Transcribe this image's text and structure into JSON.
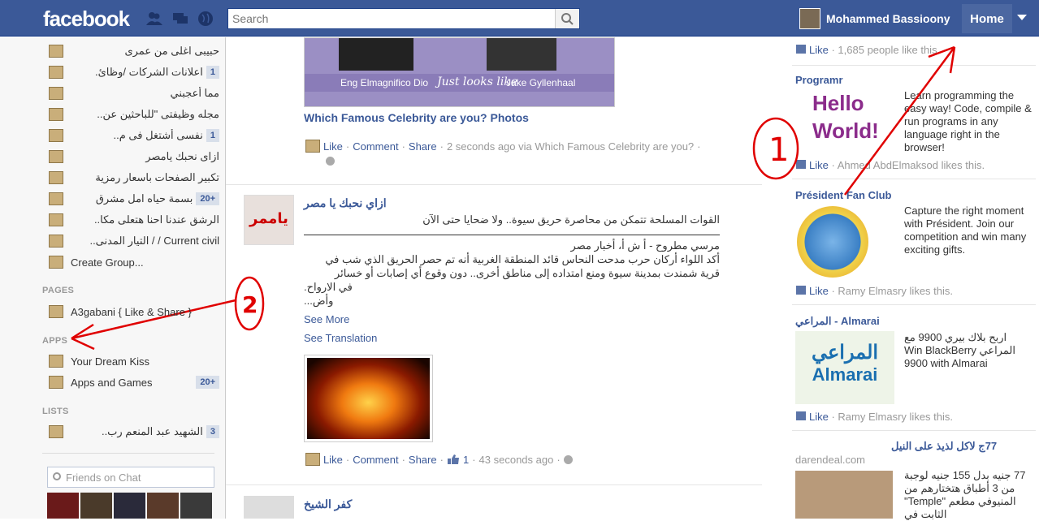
{
  "topbar": {
    "logo": "facebook",
    "search_placeholder": "Search",
    "user_name": "Mohammed Bassioony",
    "home_label": "Home"
  },
  "sidebar": {
    "items": [
      {
        "label": "حبيبى اغلى من عمرى",
        "count": ""
      },
      {
        "label": "اعلانات الشركات /وظائ.",
        "count": "1"
      },
      {
        "label": "مما أعجبني",
        "count": ""
      },
      {
        "label": "مجله وظيفتى \"للباحثين عن..",
        "count": ""
      },
      {
        "label": "نفسى أشتغل فى م..",
        "count": "1"
      },
      {
        "label": "ازاى نحبك يامصر",
        "count": ""
      },
      {
        "label": "تكبير الصفحات باسعار رمزية",
        "count": ""
      },
      {
        "label": "بسمة حياه امل مشرق",
        "count": "20+"
      },
      {
        "label": "الرشق عندنا احنا هتعلى مكا..",
        "count": ""
      },
      {
        "label": "Current civil / / التيار المدنى..",
        "count": ""
      },
      {
        "label": "Create Group...",
        "count": ""
      }
    ],
    "pages_header": "PAGES",
    "pages": [
      {
        "label": "A3gabani { Like & Share }",
        "count": ""
      }
    ],
    "apps_header": "APPS",
    "apps": [
      {
        "label": "Your Dream Kiss",
        "count": ""
      },
      {
        "label": "Apps and Games",
        "count": "20+"
      }
    ],
    "lists_header": "LISTS",
    "lists": [
      {
        "label": "الشهيد عبد المنعم رب..",
        "count": "3"
      }
    ],
    "chat_placeholder": "Friends on Chat"
  },
  "feed": {
    "photo_caption_left": "Eng Elmagnifico Dio",
    "photo_caption_mid": "Just looks like",
    "photo_caption_right": "Jake Gyllenhaal",
    "story1_title": "Which Famous Celebrity are you? Photos",
    "story1_actions": {
      "like": "Like",
      "comment": "Comment",
      "share": "Share",
      "time": "2 seconds ago via Which Famous Celebrity are you?"
    },
    "story2_author": "ازاي نحبك يا مصر",
    "story2_line1": "القوات المسلحة تتمكن من محاصرة حريق سيوة.. ولا ضحايا حتى الآن",
    "story2_line2": "مرسي مطروح - أ ش أ، أخبار مصر",
    "story2_line3": "أكد اللواء أركان حرب مدحت النحاس قائد المنطقة الغربية أنه تم حصر الحريق الذي شب في",
    "story2_line4": "قرية شمندت بمدينة سيوة ومنع امتداده إلى مناطق أخرى.. دون وقوع أي إصابات أو خسائر",
    "story2_line5": "في الارواح.",
    "story2_line6": "وأض...",
    "see_more": "See More",
    "see_translation": "See Translation",
    "story2_actions": {
      "like": "Like",
      "comment": "Comment",
      "share": "Share",
      "likes": "1",
      "time": "43 seconds ago"
    },
    "story3_author": "كفر الشيخ"
  },
  "ads": {
    "top_like": "Like",
    "top_like_text": "1,685 people like this.",
    "ad1_title": "Programr",
    "ad1_image_text1": "Hello",
    "ad1_image_text2": "World!",
    "ad1_text": "Learn programming the easy way! Code, compile & run programs in any language right in the browser!",
    "ad1_like": "Like",
    "ad1_like_text": "Ahmed AbdElmaksod likes this.",
    "ad2_title": "Président Fan Club",
    "ad2_text": "Capture the right moment with Président. Join our competition and win many exciting gifts.",
    "ad2_like": "Like",
    "ad2_like_text": "Ramy Elmasry likes this.",
    "ad3_title": "المراعي - Almarai",
    "ad3_image_ar": "المراعي",
    "ad3_image_en": "Almarai",
    "ad3_text": "اربح بلاك بيري 9900 مع المراعي Win BlackBerry 9900 with Almarai",
    "ad3_like": "Like",
    "ad3_like_text": "Ramy Elmasry likes this.",
    "ad4_title": "77ج لاكل لذيذ على النيل",
    "ad4_domain": "darendeal.com",
    "ad4_text": "77 جنيه بدل 155 جنيه لوجبة من 3 أطباق هتختارهم من المنيوفي مطعم \"Temple\" الثابت في"
  },
  "annotations": {
    "arrow1_label": "1",
    "arrow2_label": "2"
  },
  "colors": {
    "brand": "#3b5998",
    "annotation": "#e00000"
  }
}
